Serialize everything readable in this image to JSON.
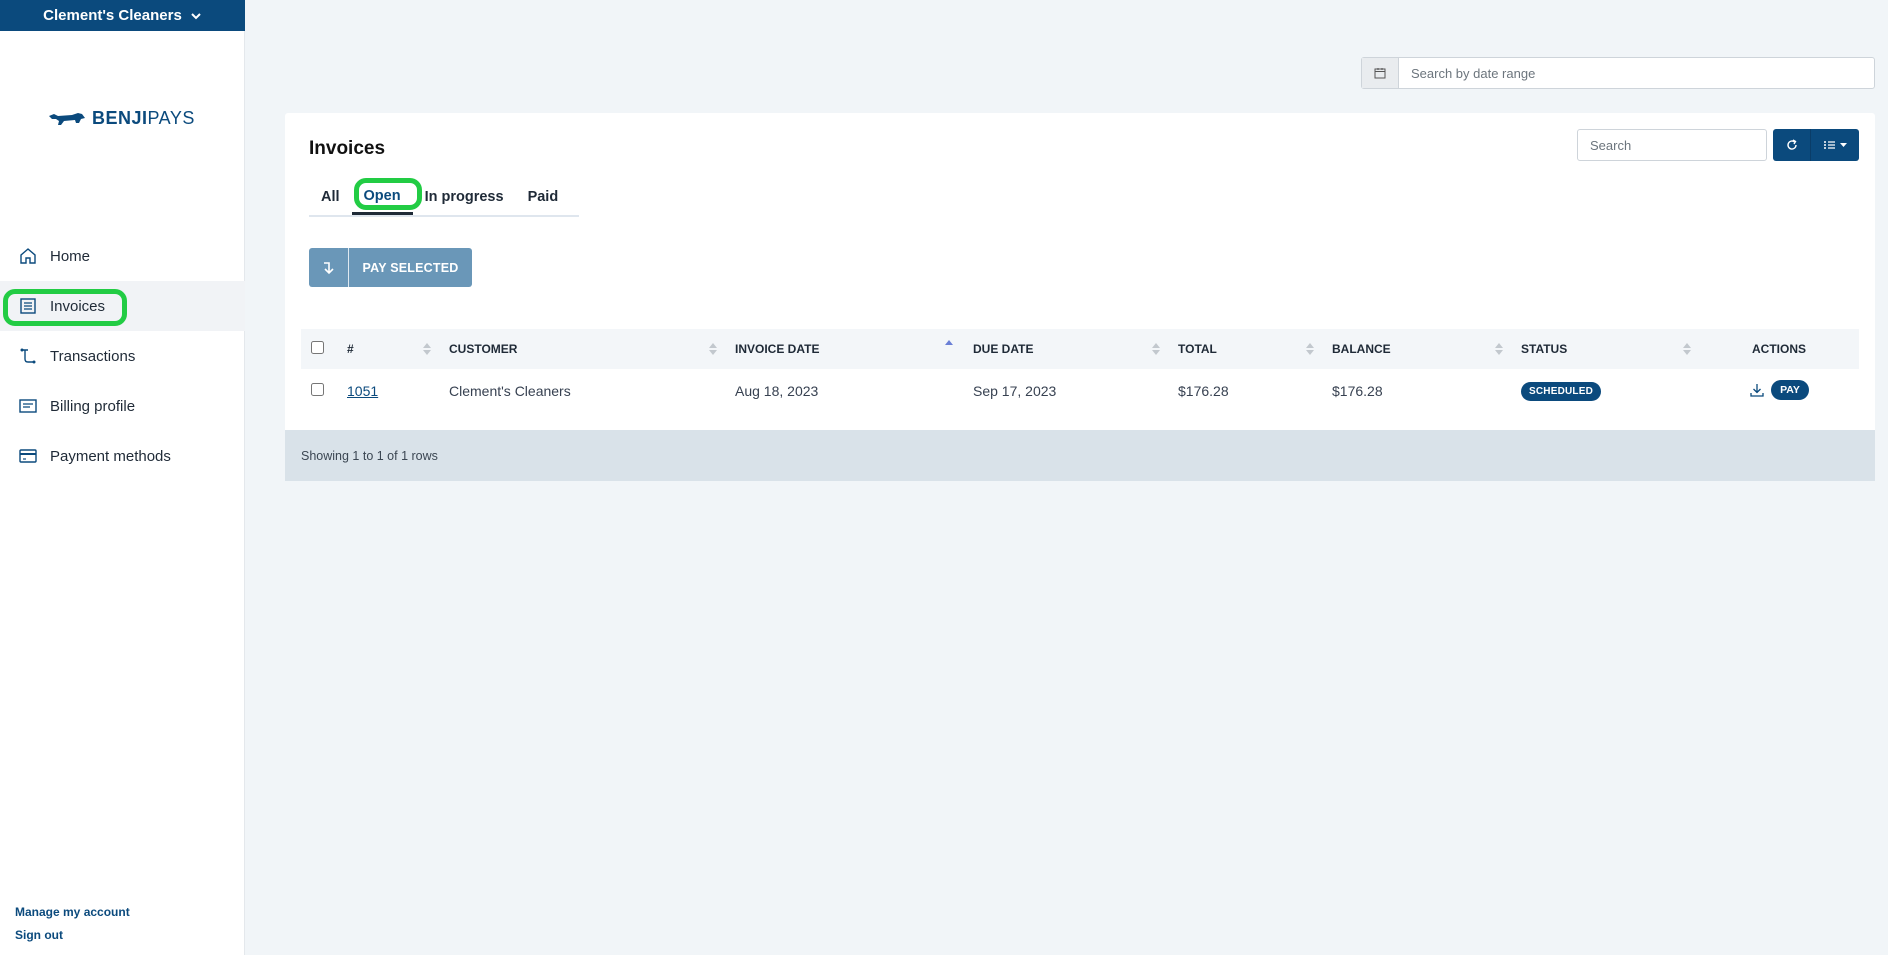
{
  "sidebar": {
    "org_name": "Clement's Cleaners",
    "logo": {
      "bold": "BENJI",
      "light": "PAYS"
    },
    "items": [
      {
        "label": "Home",
        "icon": "home-icon"
      },
      {
        "label": "Invoices",
        "icon": "invoice-icon"
      },
      {
        "label": "Transactions",
        "icon": "transactions-icon"
      },
      {
        "label": "Billing profile",
        "icon": "billing-profile-icon"
      },
      {
        "label": "Payment methods",
        "icon": "credit-card-icon"
      }
    ],
    "active_item": "Invoices",
    "bottom": {
      "manage": "Manage my account",
      "signout": "Sign out"
    }
  },
  "date_range": {
    "placeholder": "Search by date range"
  },
  "invoices": {
    "title": "Invoices",
    "tabs": [
      {
        "label": "All"
      },
      {
        "label": "Open"
      },
      {
        "label": "In progress"
      },
      {
        "label": "Paid"
      }
    ],
    "active_tab": "Open",
    "search_placeholder": "Search",
    "pay_selected_label": "PAY SELECTED",
    "columns": {
      "num": "#",
      "customer": "CUSTOMER",
      "invoice_date": "INVOICE DATE",
      "due_date": "DUE DATE",
      "total": "TOTAL",
      "balance": "BALANCE",
      "status": "STATUS",
      "actions": "ACTIONS"
    },
    "sorted_column": "INVOICE DATE",
    "rows": [
      {
        "num": "1051",
        "customer": "Clement's Cleaners",
        "invoice_date": "Aug 18, 2023",
        "due_date": "Sep 17, 2023",
        "total": "$176.28",
        "balance": "$176.28",
        "status": "SCHEDULED",
        "action_label": "PAY"
      }
    ],
    "footer": "Showing 1 to 1 of 1 rows"
  },
  "colors": {
    "brand": "#0b4a7d",
    "highlight": "#22cc44",
    "pay_selected_bg": "#6a97b8",
    "footer_bg": "#d9e2e9"
  }
}
